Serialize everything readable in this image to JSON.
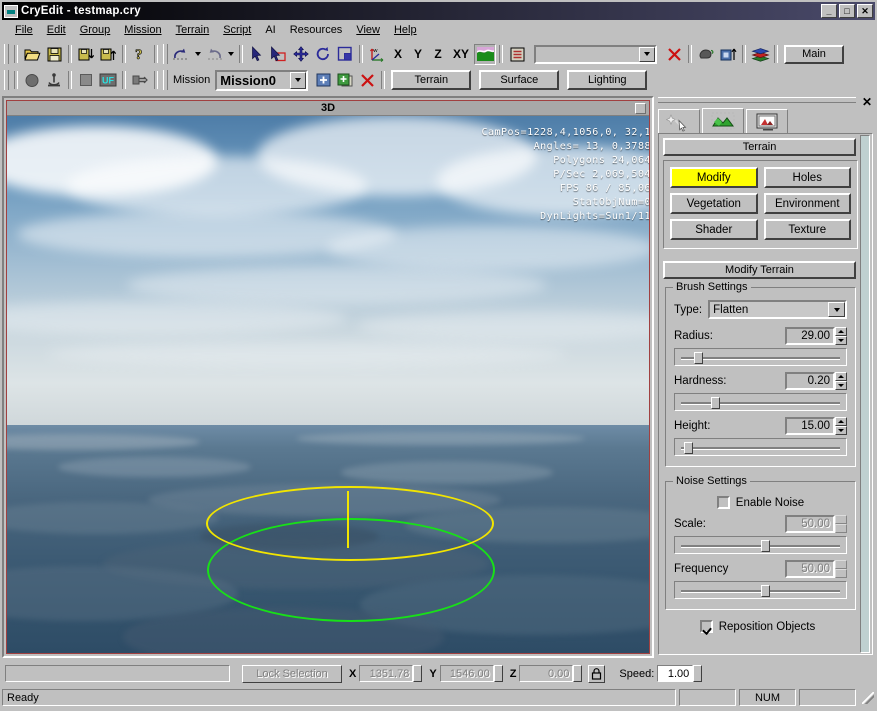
{
  "window": {
    "title": "CryEdit - testmap.cry",
    "icon": "cryedit-app-icon",
    "controls": {
      "minimize": "_",
      "maximize": "□",
      "close": "✕"
    }
  },
  "menubar": {
    "items": [
      "File",
      "Edit",
      "Group",
      "Mission",
      "Terrain",
      "Script",
      "AI",
      "Resources",
      "View",
      "Help"
    ]
  },
  "toolbar_main": {
    "buttons": [
      {
        "name": "open-file-button",
        "icon": "folder-open-icon"
      },
      {
        "name": "save-file-button",
        "icon": "floppy-save-icon"
      },
      {
        "name": "export-down-button",
        "icon": "floppy-down-icon"
      },
      {
        "name": "import-up-button",
        "icon": "floppy-up-icon"
      },
      {
        "name": "help-button",
        "icon": "question-mark-icon"
      },
      {
        "name": "undo-button",
        "icon": "undo-arrow-icon"
      },
      {
        "name": "redo-button",
        "icon": "redo-arrow-icon"
      },
      {
        "name": "select-tool-button",
        "icon": "arrow-cursor-icon"
      },
      {
        "name": "select-object-button",
        "icon": "cursor-select-box-icon"
      },
      {
        "name": "move-tool-button",
        "icon": "move-cross-arrows-icon"
      },
      {
        "name": "rotate-tool-button",
        "icon": "rotate-arrow-icon"
      },
      {
        "name": "scale-tool-button",
        "icon": "scale-square-icon"
      },
      {
        "name": "axis-world-button",
        "icon": "axis-tripod-icon"
      },
      {
        "name": "terrain-paint-button",
        "icon": "terrain-swatch-icon"
      },
      {
        "name": "layers-list-button",
        "icon": "list-lines-icon"
      },
      {
        "name": "delete-selection-button",
        "icon": "red-x-icon"
      },
      {
        "name": "goto-button",
        "icon": "dark-blob-icon"
      },
      {
        "name": "object-up-button",
        "icon": "box-up-arrow-icon"
      },
      {
        "name": "layers-stack-button",
        "icon": "layers-stack-icon"
      }
    ],
    "axis_labels": [
      "X",
      "Y",
      "Z",
      "XY"
    ],
    "layer_combo_value": "",
    "main_button_label": "Main"
  },
  "toolbar_mission": {
    "buttons": [
      {
        "name": "physics-toggle-button",
        "icon": "dark-circle-icon"
      },
      {
        "name": "ai-toggle-button",
        "icon": "anchor-figure-icon"
      },
      {
        "name": "fill-mode-button",
        "icon": "filled-square-icon"
      },
      {
        "name": "ui-toggle-button",
        "icon": "uf-label-icon"
      },
      {
        "name": "toolbox-button",
        "icon": "plug-icon"
      }
    ],
    "mission_label": "Mission",
    "mission_value": "Mission0",
    "add_mission_icon": "add-blue-icon",
    "duplicate_mission_icon": "copy-green-icon",
    "delete_mission_icon": "red-x-icon",
    "mode_buttons": [
      "Terrain",
      "Surface",
      "Lighting"
    ]
  },
  "viewport": {
    "caption": "3D",
    "close_box": "viewport-close-box",
    "overlay_lines": [
      "CamPos=1228,4,1056,0, 32,1",
      "Angles= 13, 0,3788",
      "Polygons 24,064",
      "P/Sec 2,069,504",
      "FPS  86 / 85,06",
      "StatObjNum=0",
      "DynLights=Sun1/11"
    ],
    "gizmo": {
      "outer_circle_color": "#f2e500",
      "inner_circle_color": "#18e018"
    }
  },
  "rollup": {
    "close_label": "✕",
    "tabs": [
      {
        "name": "tab-objects",
        "icon": "magic-wand-star-icon",
        "active": false
      },
      {
        "name": "tab-terrain",
        "icon": "green-terrain-icon",
        "active": true
      },
      {
        "name": "tab-display",
        "icon": "monitor-picture-icon",
        "active": false
      }
    ],
    "terrain_header": "Terrain",
    "terrain_buttons": [
      {
        "label": "Modify",
        "selected": true
      },
      {
        "label": "Holes",
        "selected": false
      },
      {
        "label": "Vegetation",
        "selected": false
      },
      {
        "label": "Environment",
        "selected": false
      },
      {
        "label": "Shader",
        "selected": false
      },
      {
        "label": "Texture",
        "selected": false
      }
    ],
    "modify_header": "Modify Terrain",
    "brush_settings": {
      "legend": "Brush Settings",
      "type_label": "Type:",
      "type_value": "Flatten",
      "sliders": [
        {
          "label": "Radius:",
          "value": "29.00",
          "percent": 11
        },
        {
          "label": "Hardness:",
          "value": "0.20",
          "percent": 21
        },
        {
          "label": "Height:",
          "value": "15.00",
          "percent": 5
        }
      ]
    },
    "noise_settings": {
      "legend": "Noise Settings",
      "enable_label": "Enable Noise",
      "enable_checked": false,
      "sliders": [
        {
          "label": "Scale:",
          "value": "50.00",
          "percent": 50,
          "disabled": true
        },
        {
          "label": "Frequency",
          "value": "50.00",
          "percent": 50,
          "disabled": true
        }
      ]
    },
    "reposition": {
      "label": "Reposition Objects",
      "checked": true
    }
  },
  "statusbar": {
    "selection_field_value": "",
    "lock_selection_label": "Lock Selection",
    "coords": [
      {
        "axis": "X",
        "value": "1351.78"
      },
      {
        "axis": "Y",
        "value": "1546.00"
      },
      {
        "axis": "Z",
        "value": "0.00"
      }
    ],
    "lock_icon": "padlock-icon",
    "speed_label": "Speed:",
    "speed_value": "1.00"
  },
  "bottombar": {
    "ready_text": "Ready",
    "panes": [
      "",
      "NUM",
      ""
    ]
  }
}
